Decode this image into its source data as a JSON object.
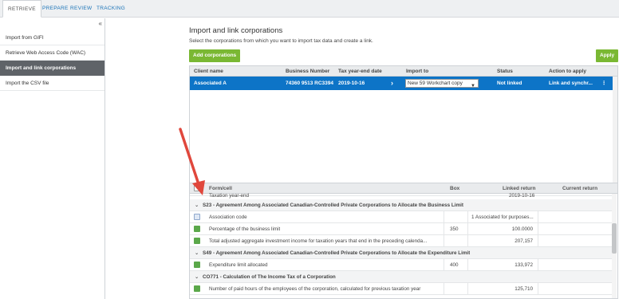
{
  "tabs": [
    {
      "label": "RETRIEVE"
    },
    {
      "label": "PREPARE"
    },
    {
      "label": "REVIEW"
    },
    {
      "label": "TRACKING"
    }
  ],
  "sidebar": {
    "collapse_glyph": "«",
    "items": [
      {
        "label": "Import from GIFI"
      },
      {
        "label": "Retrieve Web Access Code (WAC)"
      },
      {
        "label": "Import and link corporations"
      },
      {
        "label": "Import the CSV file"
      }
    ]
  },
  "main": {
    "title": "Import and link corporations",
    "subtitle": "Select the corporations from which you want to import tax data and create a link.",
    "add_button": "Add corporations",
    "apply_button": "Apply"
  },
  "corp_grid": {
    "headers": [
      "Client name",
      "Business Number",
      "Tax year-end date",
      "Import to",
      "Status",
      "Action to apply"
    ],
    "row": {
      "client": "Associated A",
      "bn": "74360 9513 RC3394",
      "date": "2019-10-16",
      "expand": "›",
      "import_to": "New 59 Workchart copy",
      "status": "Not linked",
      "action": "Link and synchr...",
      "more": "⋮"
    }
  },
  "form_grid": {
    "headers": [
      "Form/cell",
      "Box",
      "Linked return",
      "Current return"
    ],
    "partial_row": {
      "label": "Taxation year-end",
      "linked": "2019-10-16"
    },
    "rows": [
      {
        "type": "section",
        "label": "S23 - Agreement Among Associated Canadian-Controlled Private Corporations to Allocate the Business Limit"
      },
      {
        "type": "item",
        "checked": false,
        "label": "Association code",
        "box": "",
        "linked": "1 Associated for purposes..."
      },
      {
        "type": "item",
        "checked": true,
        "label": "Percentage of the business limit",
        "box": "350",
        "linked": "100.0000"
      },
      {
        "type": "item",
        "checked": true,
        "label": "Total adjusted aggregate investment income for taxation years that end in the preceding calenda...",
        "box": "",
        "linked": "207,157"
      },
      {
        "type": "section",
        "label": "S49 - Agreement Among Associated Canadian-Controlled Private Corporations to Allocate the Expenditure Limit"
      },
      {
        "type": "item",
        "checked": true,
        "label": "Expenditure limit allocated",
        "box": "400",
        "linked": "133,972"
      },
      {
        "type": "section",
        "label": "CO771 - Calculation of The Income Tax of a Corporation"
      },
      {
        "type": "item",
        "checked": true,
        "label": "Number of paid hours of the employees of the corporation, calculated for previous taxation year",
        "box": "",
        "linked": "125,710"
      }
    ]
  },
  "colors": {
    "accent_blue": "#0d74c7",
    "green": "#7ab833",
    "checkbox_green": "#5ba84a",
    "annotation_red": "#e0473c"
  }
}
